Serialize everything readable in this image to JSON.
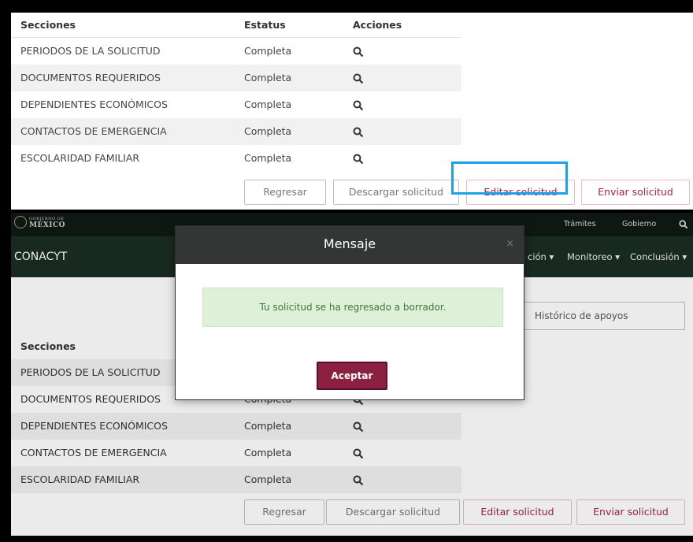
{
  "table": {
    "headers": {
      "sections": "Secciones",
      "status": "Estatus",
      "actions": "Acciones"
    },
    "rows": [
      {
        "section": "PERIODOS DE LA SOLICITUD",
        "status": "Completa"
      },
      {
        "section": "DOCUMENTOS REQUERIDOS",
        "status": "Completa"
      },
      {
        "section": "DEPENDIENTES ECONÓMICOS",
        "status": "Completa"
      },
      {
        "section": "CONTACTOS DE EMERGENCIA",
        "status": "Completa"
      },
      {
        "section": "ESCOLARIDAD FAMILIAR",
        "status": "Completa"
      }
    ],
    "action_icon": "search-icon"
  },
  "buttons": {
    "back": "Regresar",
    "download": "Descargar solicitud",
    "edit": "Editar solicitud",
    "send": "Enviar solicitud"
  },
  "bottom": {
    "gob_logo_line1": "GOBIERNO DE",
    "gob_logo_line2": "MÉXICO",
    "gob_links": [
      "Trámites",
      "Gobierno"
    ],
    "brand": "CONACYT",
    "nav_items": [
      "ción ▾",
      "Monitoreo ▾",
      "Conclusión ▾"
    ],
    "history_button": "Histórico de apoyos",
    "table_header": "Secciones",
    "rows": [
      {
        "section": "PERIODOS DE LA SOLICITUD",
        "status": ""
      },
      {
        "section": "DOCUMENTOS REQUERIDOS",
        "status": "Completa"
      },
      {
        "section": "DEPENDIENTES ECONÓMICOS",
        "status": "Completa"
      },
      {
        "section": "CONTACTOS DE EMERGENCIA",
        "status": "Completa"
      },
      {
        "section": "ESCOLARIDAD FAMILIAR",
        "status": "Completa"
      }
    ]
  },
  "modal": {
    "title": "Mensaje",
    "close": "×",
    "message": "Tu solicitud se ha regresado a borrador.",
    "ok_button": "Aceptar"
  },
  "colors": {
    "highlight": "#1aa3e8",
    "brand_primary": "#8b2141",
    "nav_bg": "#1b2d22",
    "gob_bar": "#101a14",
    "modal_header": "#343535",
    "alert_bg": "#dff0d8",
    "alert_text": "#3c763d"
  }
}
